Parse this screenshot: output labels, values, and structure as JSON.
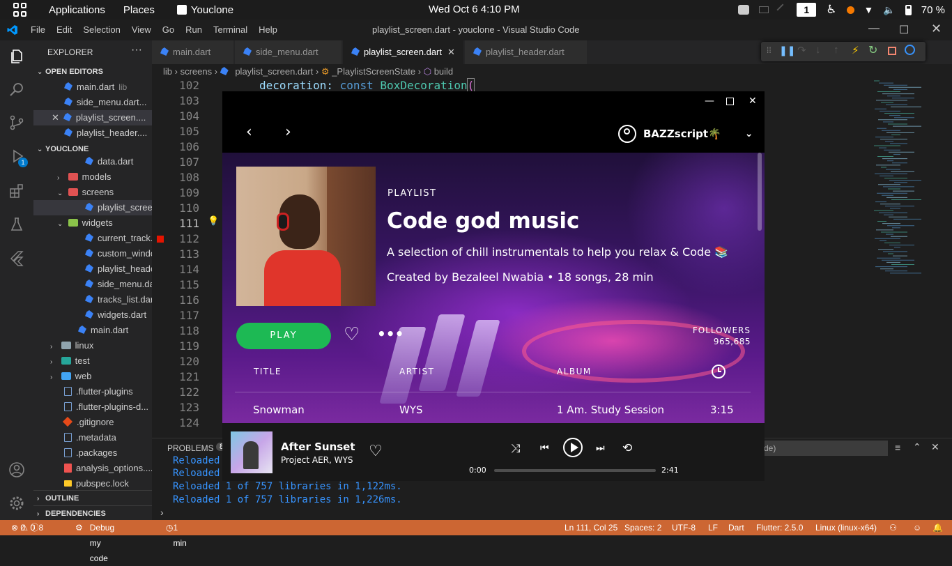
{
  "system_bar": {
    "applications": "Applications",
    "places": "Places",
    "app_name": "Youclone",
    "clock": "Wed Oct 6   4:10 PM",
    "workspace": "1",
    "battery": "70 %"
  },
  "vscode": {
    "menu": [
      "File",
      "Edit",
      "Selection",
      "View",
      "Go",
      "Run",
      "Terminal",
      "Help"
    ],
    "window_title": "playlist_screen.dart - youclone - Visual Studio Code",
    "sidebar": {
      "explorer_title": "EXPLORER",
      "open_editors_title": "OPEN EDITORS",
      "open_editors": [
        {
          "name": "main.dart",
          "hint": "lib"
        },
        {
          "name": "side_menu.dart...",
          "hint": ""
        },
        {
          "name": "playlist_screen....",
          "hint": ""
        },
        {
          "name": "playlist_header....",
          "hint": ""
        }
      ],
      "project_title": "YOUCLONE",
      "tree": [
        {
          "name": "data.dart",
          "type": "dart",
          "indent": 3
        },
        {
          "name": "models",
          "type": "folder",
          "indent": 2
        },
        {
          "name": "screens",
          "type": "folder-open",
          "indent": 2
        },
        {
          "name": "playlist_screen....",
          "type": "dart",
          "indent": 3
        },
        {
          "name": "widgets",
          "type": "folder-open",
          "indent": 2
        },
        {
          "name": "current_track....",
          "type": "dart",
          "indent": 3
        },
        {
          "name": "custom_windo...",
          "type": "dart",
          "indent": 3
        },
        {
          "name": "playlist_heade...",
          "type": "dart",
          "indent": 3
        },
        {
          "name": "side_menu.dart",
          "type": "dart",
          "indent": 3
        },
        {
          "name": "tracks_list.dart",
          "type": "dart",
          "indent": 3
        },
        {
          "name": "widgets.dart",
          "type": "dart",
          "indent": 3
        },
        {
          "name": "main.dart",
          "type": "dart",
          "indent": 2
        },
        {
          "name": "linux",
          "type": "folder",
          "indent": 1
        },
        {
          "name": "test",
          "type": "folder",
          "indent": 1
        },
        {
          "name": "web",
          "type": "folder",
          "indent": 1
        },
        {
          "name": ".flutter-plugins",
          "type": "file",
          "indent": 1
        },
        {
          "name": ".flutter-plugins-d...",
          "type": "file",
          "indent": 1
        },
        {
          "name": ".gitignore",
          "type": "git",
          "indent": 1
        },
        {
          "name": ".metadata",
          "type": "file",
          "indent": 1
        },
        {
          "name": ".packages",
          "type": "file",
          "indent": 1
        },
        {
          "name": "analysis_options....",
          "type": "yaml",
          "indent": 1
        },
        {
          "name": "pubspec.lock",
          "type": "lock",
          "indent": 1
        }
      ],
      "outline_title": "OUTLINE",
      "dependencies_title": "DEPENDENCIES"
    },
    "tabs": [
      "main.dart",
      "side_menu.dart",
      "playlist_screen.dart",
      "playlist_header.dart"
    ],
    "breadcrumb": [
      "lib",
      "screens",
      "playlist_screen.dart",
      "_PlaylistScreenState",
      "build"
    ],
    "code_line": {
      "keyword": "decoration:",
      "const": "const",
      "class": "BoxDecoration",
      "paren": "("
    },
    "line_numbers": [
      "102",
      "103",
      "104",
      "105",
      "106",
      "107",
      "108",
      "109",
      "110",
      "111",
      "112",
      "113",
      "114",
      "115",
      "116",
      "117",
      "118",
      "119",
      "120",
      "121",
      "122",
      "123",
      "124"
    ],
    "panel": {
      "problems_tab": "PROBLEMS",
      "problems_count": "8",
      "filter_suffix": "de)",
      "logs": [
        "Reloaded",
        "Reloaded",
        "Reloaded 1 of 757 libraries in 1,122ms.",
        "Reloaded 1 of 757 libraries in 1,226ms."
      ]
    },
    "status": {
      "errors": "0",
      "warnings": "0",
      "info": "8",
      "debug_config": "Debug my code",
      "time": "1 min",
      "position": "Ln 111, Col 25",
      "spaces": "Spaces: 2",
      "encoding": "UTF-8",
      "eol": "LF",
      "language": "Dart",
      "flutter": "Flutter: 2.5.0",
      "device": "Linux (linux-x64)"
    }
  },
  "app": {
    "user_name": "BAZZscript🌴",
    "playlist_label": "PLAYLIST",
    "title": "Code god music",
    "description": "A selection of chill instrumentals to help you relax & Code 📚",
    "meta": "Created by Bezaleel Nwabia • 18 songs, 28 min",
    "play_label": "PLAY",
    "followers_label": "FOLLOWERS",
    "followers_count": "965,685",
    "columns": [
      "TITLE",
      "ARTIST",
      "ALBUM"
    ],
    "tracks": [
      {
        "title": "Snowman",
        "artist": "WYS",
        "album": "1 Am. Study Session",
        "duration": "3:15"
      }
    ],
    "now_playing": {
      "title": "After Sunset",
      "artist": "Project AER, WYS",
      "elapsed": "0:00",
      "total": "2:41",
      "progress": 0
    },
    "colors": {
      "accent": "#1db954",
      "status_bar": "#cc6633"
    }
  }
}
